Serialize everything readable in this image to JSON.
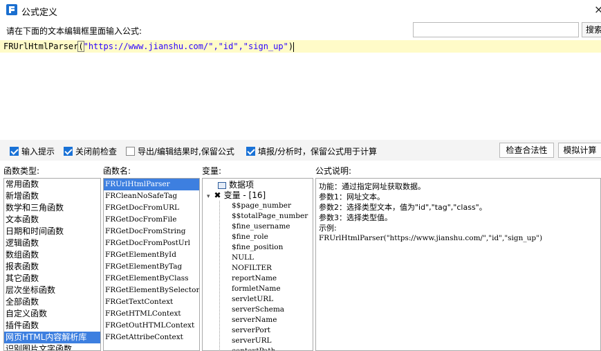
{
  "window": {
    "title": "公式定义",
    "close_glyph": "×"
  },
  "prompt": {
    "label": "请在下面的文本编辑框里面输入公式:",
    "search_placeholder": "",
    "search_button": "搜索"
  },
  "editor": {
    "fn": "FRUrlHtmlParser",
    "paren_open": "(",
    "args": "\"https://www.jianshu.com/\",\"id\",\"sign_up\"",
    "paren_close": ")"
  },
  "options": {
    "input_hint": {
      "label": "输入提示",
      "checked": true
    },
    "check_before_close": {
      "label": "关闭前检查",
      "checked": true
    },
    "keep_formula_export": {
      "label": "导出/编辑结果时,保留公式",
      "checked": false
    },
    "keep_formula_fill": {
      "label": "填报/分析时，保留公式用于计算",
      "checked": true
    },
    "validate_button": "检查合法性",
    "simulate_button": "模拟计算"
  },
  "headers": {
    "func_types": "函数类型:",
    "func_names": "函数名:",
    "variables": "变量:",
    "description": "公式说明:"
  },
  "func_types": [
    "常用函数",
    "新增函数",
    "数学和三角函数",
    "文本函数",
    "日期和时间函数",
    "逻辑函数",
    "数组函数",
    "报表函数",
    "其它函数",
    "层次坐标函数",
    "全部函数",
    "自定义函数",
    "插件函数",
    "网页HTML内容解析库",
    "识别图片文字函数"
  ],
  "func_types_selected": 13,
  "func_names": [
    "FRUrlHtmlParser",
    "FRCleanNoSafeTag",
    "FRGetDocFromURL",
    "FRGetDocFromFile",
    "FRGetDocFromString",
    "FRGetDocFromPostUrl",
    "FRGetElementById",
    "FRGetElementByTag",
    "FRGetElementByClass",
    "FRGetElementBySelector",
    "FRGetTextContext",
    "FRGetHTMLContext",
    "FRGetOutHTMLContext",
    "FRGetAttribeContext"
  ],
  "func_names_selected": 0,
  "variables": {
    "data_item": "数据项",
    "var_group": "变量 - [16]",
    "items": [
      "$$page_number",
      "$$totalPage_number",
      "$fine_username",
      "$fine_role",
      "$fine_position",
      "NULL",
      "NOFILTER",
      "reportName",
      "formletName",
      "servletURL",
      "serverSchema",
      "serverName",
      "serverPort",
      "serverURL",
      "contextPath"
    ]
  },
  "description": [
    "功能：通过指定网址获取数据。",
    "参数1：网址文本。",
    "参数2：选择类型文本，值为\"id\",\"tag\",\"class\"。",
    "参数3：选择类型值。",
    "示例:",
    "FRUrlHtmlParser(\"https://www.jianshu.com/\",\"id\",\"sign_up\")"
  ]
}
